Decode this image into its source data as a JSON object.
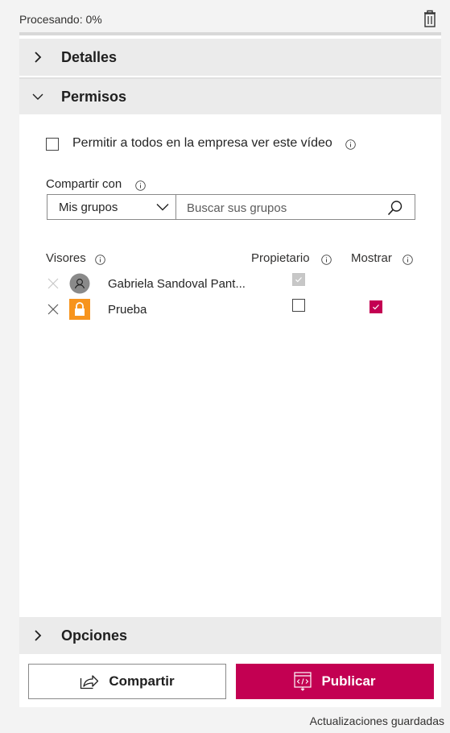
{
  "status": {
    "processing": "Procesando: 0%",
    "saved": "Actualizaciones guardadas"
  },
  "sections": {
    "details": "Detalles",
    "permissions": "Permisos",
    "options": "Opciones"
  },
  "permissions": {
    "allow_all_label": "Permitir a todos en la empresa ver este vídeo",
    "allow_all_checked": false,
    "share_with_label": "Compartir con",
    "group_select_value": "Mis grupos",
    "search_placeholder": "Buscar sus grupos",
    "columns": {
      "viewers": "Visores",
      "owner": "Propietario",
      "show": "Mostrar"
    },
    "viewers": [
      {
        "name": "Gabriela Sandoval Pant...",
        "icon": "person-avatar-icon",
        "owner": true,
        "owner_disabled": true,
        "show": false
      },
      {
        "name": "Prueba",
        "icon": "lock-group-icon",
        "owner": false,
        "owner_disabled": false,
        "show": true
      }
    ]
  },
  "actions": {
    "share": "Compartir",
    "publish": "Publicar"
  },
  "colors": {
    "accent": "#c30052",
    "group_icon": "#f7941d",
    "section_bg": "#ebebeb"
  },
  "icons": {
    "trash": "trash-icon",
    "info": "info-icon",
    "search": "search-icon",
    "chevron_down": "chevron-down-icon",
    "chevron_right": "chevron-right-icon",
    "remove": "close-icon",
    "share": "share-arrow-icon",
    "publish": "publish-embed-icon"
  }
}
